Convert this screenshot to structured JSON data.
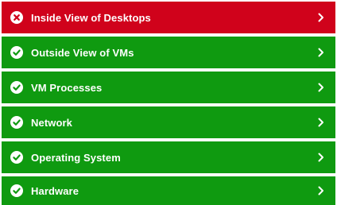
{
  "colors": {
    "fail": "#d0021b",
    "pass": "#0f9a10",
    "text": "#ffffff"
  },
  "checks": [
    {
      "label": "Inside View of Desktops",
      "status": "fail",
      "icon": "x-circle-icon"
    },
    {
      "label": "Outside View of VMs",
      "status": "pass",
      "icon": "check-circle-icon"
    },
    {
      "label": "VM Processes",
      "status": "pass",
      "icon": "check-circle-icon"
    },
    {
      "label": "Network",
      "status": "pass",
      "icon": "check-circle-icon"
    },
    {
      "label": "Operating System",
      "status": "pass",
      "icon": "check-circle-icon"
    },
    {
      "label": "Hardware",
      "status": "pass",
      "icon": "check-circle-icon"
    }
  ]
}
